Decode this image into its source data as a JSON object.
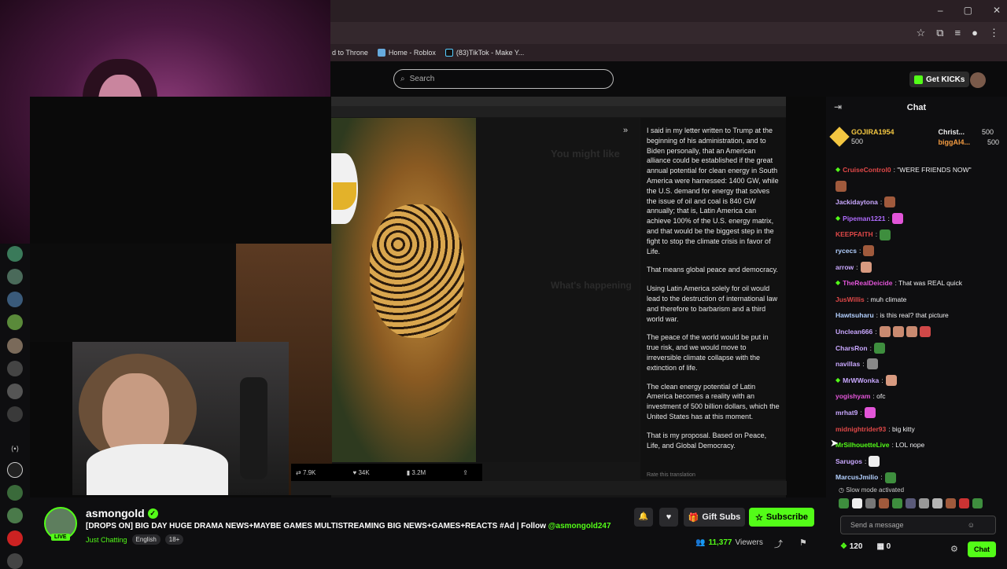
{
  "browser": {
    "window_controls": [
      "–",
      "▢",
      "✕"
    ],
    "bookmarks": [
      {
        "label": "d to Throne",
        "color": "#c43"
      },
      {
        "label": "Home - Roblox",
        "color": "#6ad"
      },
      {
        "label": "(83)TikTok - Make Y...",
        "color": "#111"
      }
    ]
  },
  "header": {
    "search_placeholder": "Search",
    "get_kicks_label": "Get KICKs"
  },
  "screenshot": {
    "paragraphs": [
      "I said in my letter written to Trump at the beginning of his administration, and to Biden personally, that an American alliance could be established if the great annual potential for clean energy in South America were harnessed: 1400 GW, while the U.S. demand for energy that solves the issue of oil and coal is 840 GW annually; that is, Latin America can achieve 100% of the U.S. energy matrix, and that would be the biggest step in the fight to stop the climate crisis in favor of Life.",
      "That means global peace and democracy.",
      "Using Latin America solely for oil would lead to the destruction of international law and therefore to barbarism and a third world war.",
      "The peace of the world would be put in true risk, and we would move to irreversible climate collapse with the extinction of life.",
      "The clean energy potential of Latin America becomes a reality with an investment of 500 billion dollars, which the United States has at this moment.",
      "That is my proposal. Based on Peace, Life, and Global Democracy."
    ],
    "rate_translation": "Rate this translation",
    "you_might_like": "You might like",
    "whats_happening": "What's happening",
    "replies": "7.9K",
    "likes": "34K",
    "views": "3.2M"
  },
  "stream": {
    "streamer": "asmongold",
    "live": "LIVE",
    "title_main": "[DROPS ON] BIG DAY HUGE DRAMA NEWS+MAYBE GAMES MULTISTREAMING BIG NEWS+GAMES+REACTS #Ad | Follow ",
    "title_link": "@asmongold247",
    "category": "Just Chatting",
    "tags": [
      "English",
      "18+"
    ],
    "gift_subs": "Gift Subs",
    "subscribe": "Subscribe",
    "viewers": "11,377",
    "viewers_label": "Viewers"
  },
  "chat": {
    "header": "Chat",
    "pinned": [
      {
        "name": "GOJIRA1954",
        "amount": "500",
        "color": "#f3c641"
      },
      {
        "name": "Christ...",
        "amount": "500",
        "color": "#eee"
      },
      {
        "name": "biggAl4...",
        "amount": "500",
        "color": "#f39b41"
      }
    ],
    "messages": [
      {
        "user": "CruiseControl0",
        "color": "#e04848",
        "text": ": \"WERE FRIENDS NOW\"",
        "badge": true,
        "emotes": []
      },
      {
        "user": "",
        "color": "#fff",
        "text": "",
        "badge": false,
        "emotes": [
          "#a05a3c"
        ]
      },
      {
        "user": "Jackidaytona",
        "color": "#c9a8ff",
        "text": ":",
        "badge": false,
        "emotes": [
          "#a05a3c"
        ]
      },
      {
        "user": "Pipeman1221",
        "color": "#b06cff",
        "text": ":",
        "badge": true,
        "emotes": [
          "#e255d8"
        ]
      },
      {
        "user": "KEEPFAITH",
        "color": "#e04848",
        "text": ":",
        "badge": false,
        "emotes": [
          "#3e8e3e"
        ]
      },
      {
        "user": "rycecs",
        "color": "#b3d0ff",
        "text": ":",
        "badge": false,
        "emotes": [
          "#a05a3c"
        ]
      },
      {
        "user": "arrow",
        "color": "#c9a8ff",
        "text": ":",
        "badge": false,
        "emotes": [
          "#d89a80"
        ]
      },
      {
        "user": "TheRealDeicide",
        "color": "#e255d8",
        "text": ": That was REAL quick",
        "badge": true,
        "emotes": []
      },
      {
        "user": "JusWillis",
        "color": "#e04848",
        "text": ": muh climate",
        "badge": false,
        "emotes": []
      },
      {
        "user": "Hawtsuharu",
        "color": "#b3d0ff",
        "text": ": is this real? that picture",
        "badge": false,
        "emotes": []
      },
      {
        "user": "Unclean666",
        "color": "#c9a8ff",
        "text": ":",
        "badge": false,
        "emotes": [
          "#c98a70",
          "#c98a70",
          "#c98a70",
          "#d04848"
        ]
      },
      {
        "user": "CharsRon",
        "color": "#c9a8ff",
        "text": ":",
        "badge": false,
        "emotes": [
          "#3e8e3e"
        ]
      },
      {
        "user": "navillas",
        "color": "#c9a8ff",
        "text": ":",
        "badge": false,
        "emotes": [
          "#888"
        ]
      },
      {
        "user": "MrWWonka",
        "color": "#c9a8ff",
        "text": ":",
        "badge": true,
        "emotes": [
          "#d89a80"
        ]
      },
      {
        "user": "yogishyam",
        "color": "#e255d8",
        "text": ": ofc",
        "badge": false,
        "emotes": []
      },
      {
        "user": "mrhat9",
        "color": "#c9a8ff",
        "text": ":",
        "badge": false,
        "emotes": [
          "#e255d8"
        ]
      },
      {
        "user": "midnightrider93",
        "color": "#e04848",
        "text": ": big kitty",
        "badge": false,
        "emotes": []
      },
      {
        "user": "MrSilhouetteLive",
        "color": "#53fc18",
        "text": ": LOL nope",
        "badge": false,
        "emotes": []
      },
      {
        "user": "Sarugos",
        "color": "#c9a8ff",
        "text": ":",
        "badge": false,
        "emotes": [
          "#eee"
        ]
      },
      {
        "user": "MarcusJmilio",
        "color": "#b3d0ff",
        "text": ":",
        "badge": false,
        "emotes": [
          "#3e8e3e"
        ]
      }
    ],
    "slow_mode": "Slow mode activated",
    "input_placeholder": "Send a message",
    "points": "120",
    "store": "0",
    "send_label": "Chat"
  },
  "colors": {
    "accent": "#53fc18"
  }
}
